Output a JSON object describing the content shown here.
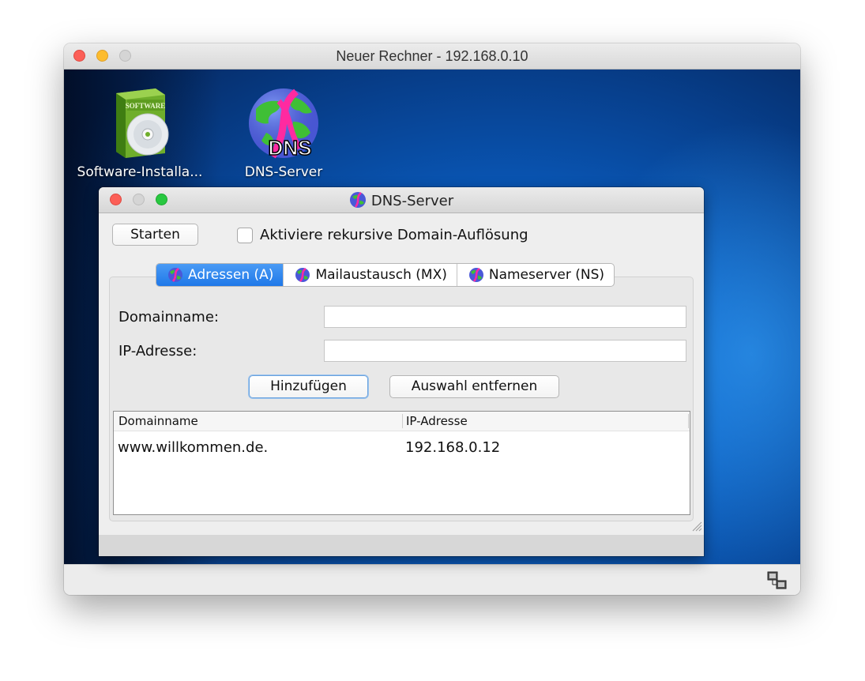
{
  "outer_window": {
    "title": "Neuer Rechner - 192.168.0.10"
  },
  "desktop": {
    "icons": [
      {
        "label": "Software-Installa...",
        "icon": "software-box-icon",
        "badge_text": "SOFTWARE"
      },
      {
        "label": "DNS-Server",
        "icon": "dns-globe-icon",
        "badge_text": "DNS"
      }
    ]
  },
  "dns_window": {
    "title": "DNS-Server",
    "start_button": "Starten",
    "recursive_checkbox_label": "Aktiviere rekursive Domain-Auflösung",
    "recursive_checked": false,
    "tabs": [
      {
        "label": "Adressen (A)",
        "active": true
      },
      {
        "label": "Mailaustausch (MX)",
        "active": false
      },
      {
        "label": "Nameserver (NS)",
        "active": false
      }
    ],
    "form": {
      "domain_label": "Domainname:",
      "domain_value": "",
      "ip_label": "IP-Adresse:",
      "ip_value": "",
      "add_button": "Hinzufügen",
      "remove_button": "Auswahl entfernen"
    },
    "table": {
      "columns": [
        "Domainname",
        "IP-Adresse"
      ],
      "rows": [
        [
          "www.willkommen.de.",
          "192.168.0.12"
        ]
      ]
    }
  },
  "colors": {
    "accent": "#1f78e8",
    "desktop_blue": "#0a5cbf",
    "close": "#fc5f57",
    "minimize": "#fdbc2e",
    "maximize": "#28c840"
  }
}
